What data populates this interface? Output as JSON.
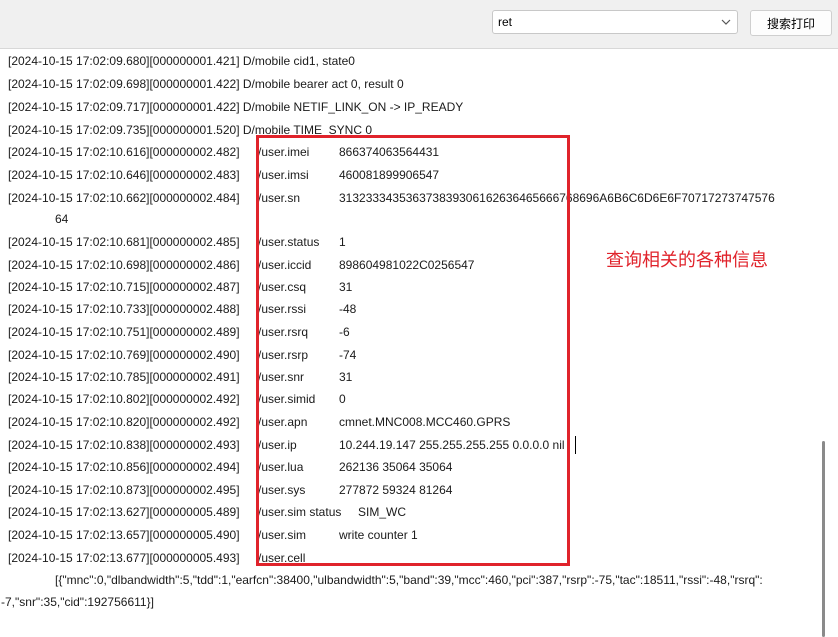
{
  "toolbar": {
    "filter_value": "ret",
    "search_print_label": "搜索打印"
  },
  "log": {
    "lines": [
      {
        "text": "[2024-10-15 17:02:09.680][000000001.421] D/mobile cid1, state0"
      },
      {
        "text": "[2024-10-15 17:02:09.698][000000001.422] D/mobile bearer act 0, result 0"
      },
      {
        "text": "[2024-10-15 17:02:09.717][000000001.422] D/mobile NETIF_LINK_ON -> IP_READY"
      },
      {
        "text": "[2024-10-15 17:02:09.735][000000001.520] D/mobile TIME_SYNC 0"
      }
    ],
    "user_lines": [
      {
        "ts": "[2024-10-15 17:02:10.616][000000002.482]",
        "key": "/user.imei",
        "val": "866374063564431"
      },
      {
        "ts": "[2024-10-15 17:02:10.646][000000002.483]",
        "key": "/user.imsi",
        "val": "460081899906547"
      },
      {
        "ts": "[2024-10-15 17:02:10.662][000000002.484]",
        "key": "/user.sn",
        "val": "313233343536373839306162636465666768696A6B6C6D6E6F70717273747576"
      },
      {
        "ts": "[2024-10-15 17:02:10.681][000000002.485]",
        "key": "/user.status",
        "val": "1"
      },
      {
        "ts": "[2024-10-15 17:02:10.698][000000002.486]",
        "key": "/user.iccid",
        "val": "898604981022C0256547"
      },
      {
        "ts": "[2024-10-15 17:02:10.715][000000002.487]",
        "key": "/user.csq",
        "val": "31"
      },
      {
        "ts": "[2024-10-15 17:02:10.733][000000002.488]",
        "key": "/user.rssi",
        "val": "-48"
      },
      {
        "ts": "[2024-10-15 17:02:10.751][000000002.489]",
        "key": "/user.rsrq",
        "val": "-6"
      },
      {
        "ts": "[2024-10-15 17:02:10.769][000000002.490]",
        "key": "/user.rsrp",
        "val": "-74"
      },
      {
        "ts": "[2024-10-15 17:02:10.785][000000002.491]",
        "key": "/user.snr",
        "val": "31"
      },
      {
        "ts": "[2024-10-15 17:02:10.802][000000002.492]",
        "key": "/user.simid",
        "val": "0"
      },
      {
        "ts": "[2024-10-15 17:02:10.820][000000002.492]",
        "key": "/user.apn",
        "val": "cmnet.MNC008.MCC460.GPRS"
      },
      {
        "ts": "[2024-10-15 17:02:10.838][000000002.493]",
        "key": "/user.ip",
        "val": "10.244.19.147     255.255.255.255 0.0.0.0   nil"
      },
      {
        "ts": "[2024-10-15 17:02:10.856][000000002.494]",
        "key": "/user.lua",
        "val": "262136  35064    35064"
      },
      {
        "ts": "[2024-10-15 17:02:10.873][000000002.495]",
        "key": "/user.sys",
        "val": "277872  59324    81264"
      },
      {
        "ts": "[2024-10-15 17:02:13.627][000000005.489]",
        "key": "/user.sim status",
        "val": "SIM_WC"
      },
      {
        "ts": "[2024-10-15 17:02:13.657][000000005.490]",
        "key": "/user.sim",
        "val": "write counter    1"
      },
      {
        "ts": "[2024-10-15 17:02:13.677][000000005.493]",
        "key": "/user.cell",
        "val": ""
      }
    ],
    "sn_wrap": "64",
    "cell_json_1": "[{\"mnc\":0,\"dlbandwidth\":5,\"tdd\":1,\"earfcn\":38400,\"ulbandwidth\":5,\"band\":39,\"mcc\":460,\"pci\":387,\"rsrp\":-75,\"tac\":18511,\"rssi\":-48,\"rsrq\":",
    "cell_json_2": "-7,\"snr\":35,\"cid\":192756611}]"
  },
  "annotation": {
    "text": "查询相关的各种信息",
    "color": "#e0232b"
  }
}
